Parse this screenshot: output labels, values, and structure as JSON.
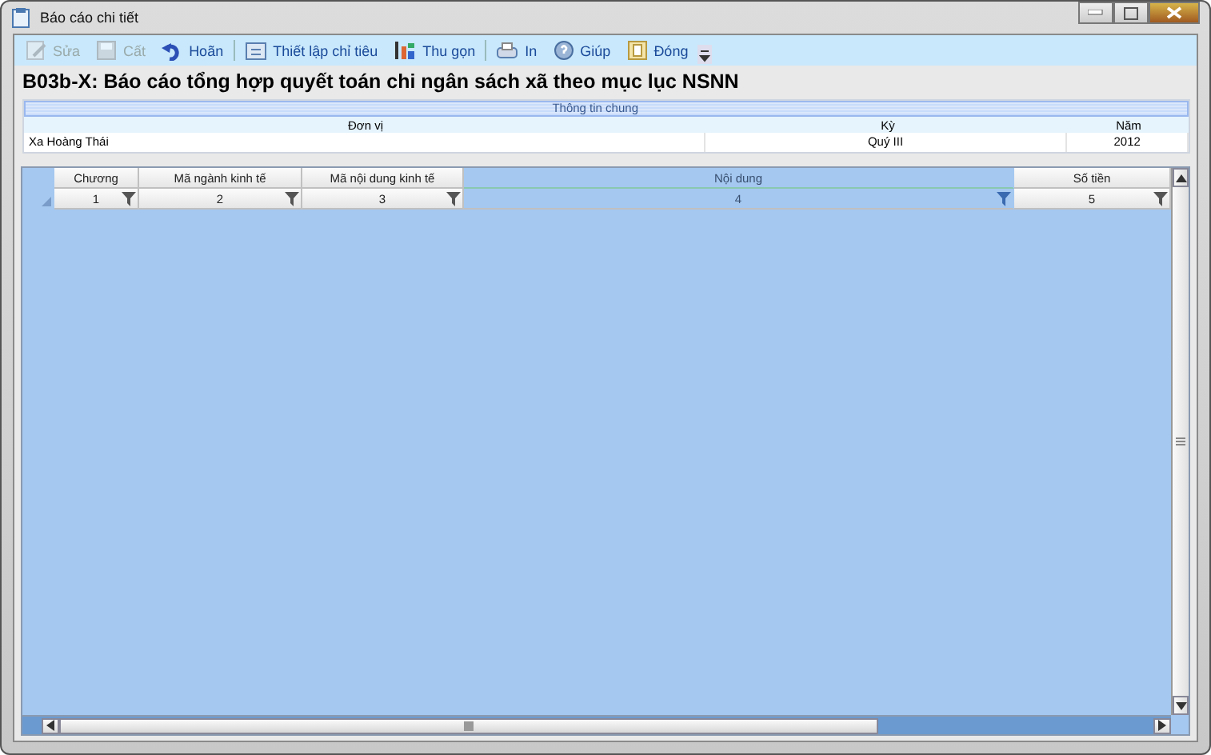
{
  "window": {
    "title": "Báo cáo chi tiết"
  },
  "toolbar": [
    {
      "label": "Sửa",
      "kind": "edit",
      "disabled": true
    },
    {
      "label": "Cất",
      "kind": "save",
      "disabled": true
    },
    {
      "label": "Hoãn",
      "kind": "undo",
      "disabled": false
    },
    {
      "label": "Thiết lập chỉ tiêu",
      "kind": "setup",
      "disabled": false
    },
    {
      "label": "Thu gọn",
      "kind": "collapse",
      "disabled": false
    },
    {
      "label": "In",
      "kind": "print",
      "disabled": false
    },
    {
      "label": "Giúp",
      "kind": "help",
      "disabled": false
    },
    {
      "label": "Đóng",
      "kind": "close",
      "disabled": false
    }
  ],
  "heading": "B03b-X: Báo cáo tổng hợp quyết toán chi ngân sách xã theo mục lục NSNN",
  "general_info": {
    "title": "Thông tin chung",
    "columns": [
      "Đơn vị",
      "Kỳ",
      "Năm"
    ],
    "values": [
      "Xa Hoàng Thái",
      "Quý III",
      "2012"
    ]
  },
  "table": {
    "columns": [
      {
        "label": "Chương",
        "number": "1",
        "selected": false
      },
      {
        "label": "Mã ngành kinh tế",
        "number": "2",
        "selected": false
      },
      {
        "label": "Mã nội dung kinh tế",
        "number": "3",
        "selected": false
      },
      {
        "label": "Nội dung",
        "number": "4",
        "selected": true
      },
      {
        "label": "Số tiền",
        "number": "5",
        "selected": false
      }
    ]
  }
}
